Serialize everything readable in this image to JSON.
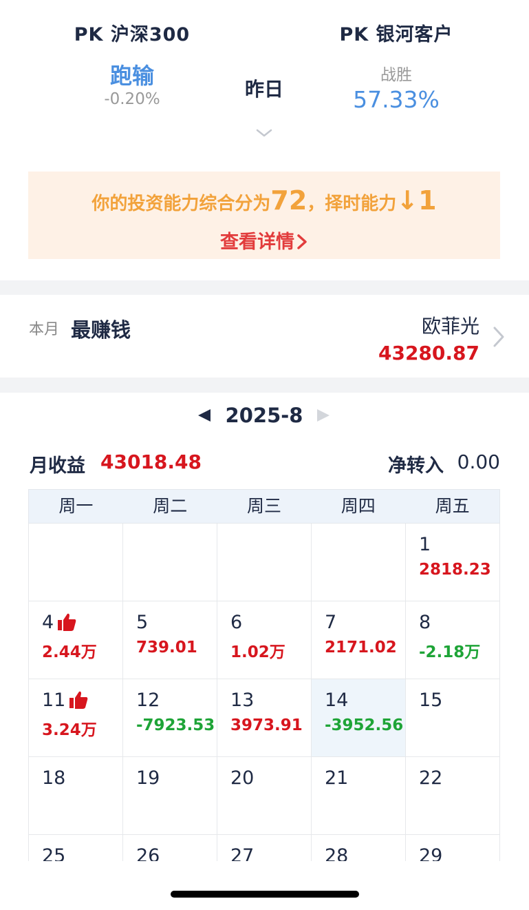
{
  "pk": {
    "left": {
      "title": "PK 沪深300",
      "result": "跑输",
      "change": "-0.20%"
    },
    "period": "昨日",
    "right": {
      "title": "PK 银河客户",
      "result_label": "战胜",
      "win_rate": "57.33%"
    }
  },
  "banner": {
    "prefix": "你的投资能力综合分为",
    "score": "72",
    "middle": "，择时能力",
    "arrow": "↓",
    "change": "1",
    "link": "查看详情"
  },
  "best_earner": {
    "period": "本月",
    "title": "最赚钱",
    "name": "欧菲光",
    "amount": "43280.87"
  },
  "month_nav": {
    "label": "2025-8"
  },
  "summary": {
    "income_label": "月收益",
    "income_value": "43018.48",
    "net_label": "净转入",
    "net_value": "0.00"
  },
  "calendar": {
    "weekdays": [
      "周一",
      "周二",
      "周三",
      "周四",
      "周五"
    ],
    "cells": [
      {
        "day": "",
        "pnl": "",
        "sign": ""
      },
      {
        "day": "",
        "pnl": "",
        "sign": ""
      },
      {
        "day": "",
        "pnl": "",
        "sign": ""
      },
      {
        "day": "",
        "pnl": "",
        "sign": ""
      },
      {
        "day": "1",
        "pnl": "2818.23",
        "sign": "pos"
      },
      {
        "day": "4",
        "pnl": "2.44万",
        "sign": "pos",
        "thumb": true
      },
      {
        "day": "5",
        "pnl": "739.01",
        "sign": "pos"
      },
      {
        "day": "6",
        "pnl": "1.02万",
        "sign": "pos"
      },
      {
        "day": "7",
        "pnl": "2171.02",
        "sign": "pos"
      },
      {
        "day": "8",
        "pnl": "-2.18万",
        "sign": "neg"
      },
      {
        "day": "11",
        "pnl": "3.24万",
        "sign": "pos",
        "thumb": true
      },
      {
        "day": "12",
        "pnl": "-7923.53",
        "sign": "neg"
      },
      {
        "day": "13",
        "pnl": "3973.91",
        "sign": "pos"
      },
      {
        "day": "14",
        "pnl": "-3952.56",
        "sign": "neg",
        "highlight": true
      },
      {
        "day": "15",
        "pnl": "",
        "sign": ""
      },
      {
        "day": "18",
        "pnl": "",
        "sign": ""
      },
      {
        "day": "19",
        "pnl": "",
        "sign": ""
      },
      {
        "day": "20",
        "pnl": "",
        "sign": ""
      },
      {
        "day": "21",
        "pnl": "",
        "sign": ""
      },
      {
        "day": "22",
        "pnl": "",
        "sign": ""
      },
      {
        "day": "25",
        "pnl": "",
        "sign": ""
      },
      {
        "day": "26",
        "pnl": "",
        "sign": ""
      },
      {
        "day": "27",
        "pnl": "",
        "sign": ""
      },
      {
        "day": "28",
        "pnl": "",
        "sign": ""
      },
      {
        "day": "29",
        "pnl": "",
        "sign": ""
      }
    ]
  },
  "colors": {
    "positive": "#d7161e",
    "negative": "#1ea437",
    "accent_blue": "#4a8fe0",
    "banner_orange": "#f2a23b",
    "link_red": "#e23c3c"
  }
}
